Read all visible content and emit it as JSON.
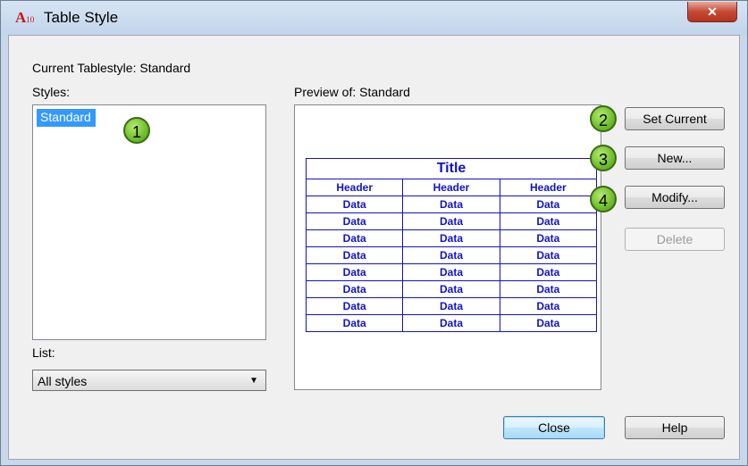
{
  "window": {
    "title": "Table Style",
    "app_icon_label": "A",
    "app_icon_sub": "10"
  },
  "current_style_label": "Current Tablestyle: Standard",
  "styles": {
    "label": "Styles:",
    "items": [
      "Standard"
    ]
  },
  "list": {
    "label": "List:",
    "selected": "All styles"
  },
  "preview": {
    "label": "Preview of: Standard",
    "table": {
      "title": "Title",
      "headers": [
        "Header",
        "Header",
        "Header"
      ],
      "rows": [
        [
          "Data",
          "Data",
          "Data"
        ],
        [
          "Data",
          "Data",
          "Data"
        ],
        [
          "Data",
          "Data",
          "Data"
        ],
        [
          "Data",
          "Data",
          "Data"
        ],
        [
          "Data",
          "Data",
          "Data"
        ],
        [
          "Data",
          "Data",
          "Data"
        ],
        [
          "Data",
          "Data",
          "Data"
        ],
        [
          "Data",
          "Data",
          "Data"
        ]
      ]
    }
  },
  "buttons": {
    "set_current": "Set Current",
    "new": "New...",
    "modify": "Modify...",
    "delete": "Delete",
    "close": "Close",
    "help": "Help"
  },
  "markers": [
    "1",
    "2",
    "3",
    "4"
  ],
  "colors": {
    "preview_blue": "#1212c8",
    "selection": "#3399ff",
    "marker_green": "#6dbd2c",
    "close_red": "#c54a34"
  },
  "icons": {
    "close": "close-icon",
    "dropdown": "chevron-down-icon",
    "app": "autocad-icon"
  }
}
